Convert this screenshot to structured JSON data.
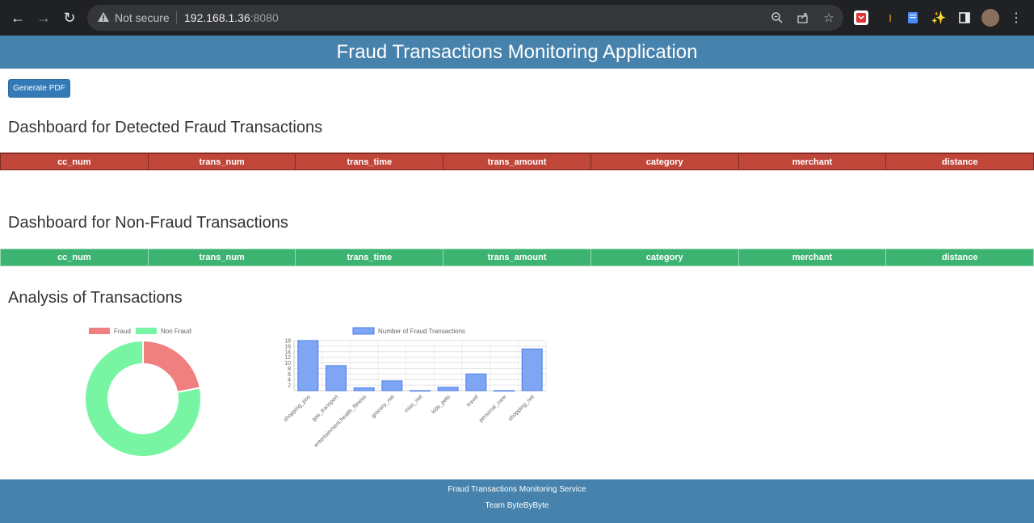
{
  "browser": {
    "security_label": "Not secure",
    "url_host": "192.168.1.36",
    "url_port": ":8080"
  },
  "app": {
    "title": "Fraud Transactions Monitoring Application",
    "pdf_button": "Generate PDF"
  },
  "sections": {
    "fraud_title": "Dashboard for Detected Fraud Transactions",
    "nonfraud_title": "Dashboard for Non-Fraud Transactions",
    "analysis_title": "Analysis of Transactions"
  },
  "columns": [
    "cc_num",
    "trans_num",
    "trans_time",
    "trans_amount",
    "category",
    "merchant",
    "distance"
  ],
  "colors": {
    "header_bg": "#4682ac",
    "fraud_header": "#c0463a",
    "nonfraud_header": "#3cb371",
    "button": "#337ab7",
    "doughnut_fraud": "#f08080",
    "doughnut_nonfraud": "#77f5a3",
    "bar_fill": "#7ea6f5",
    "bar_stroke": "#4b7be5"
  },
  "chart_data": [
    {
      "type": "pie",
      "variant": "doughnut",
      "legend": [
        "Fraud",
        "Non Fraud"
      ],
      "values": [
        22,
        78
      ],
      "legend_position": "top"
    },
    {
      "type": "bar",
      "legend": [
        "Number of Fraud Transactions"
      ],
      "categories": [
        "shopping_pos",
        "gas_transport",
        "entertainment,health_fitness",
        "grocery_net",
        "misc_net",
        "kids_pets",
        "travel",
        "personal_care",
        "shopping_net"
      ],
      "values": [
        18,
        9,
        1,
        3.5,
        0,
        1.2,
        6,
        0,
        15
      ],
      "yticks": [
        2,
        4,
        6,
        8,
        10,
        12,
        14,
        16,
        18
      ],
      "ylim": [
        0,
        18
      ],
      "grid": true,
      "legend_position": "top"
    }
  ],
  "footer": {
    "line1": "Fraud Transactions Monitoring Service",
    "line2": "Team ByteByByte"
  }
}
